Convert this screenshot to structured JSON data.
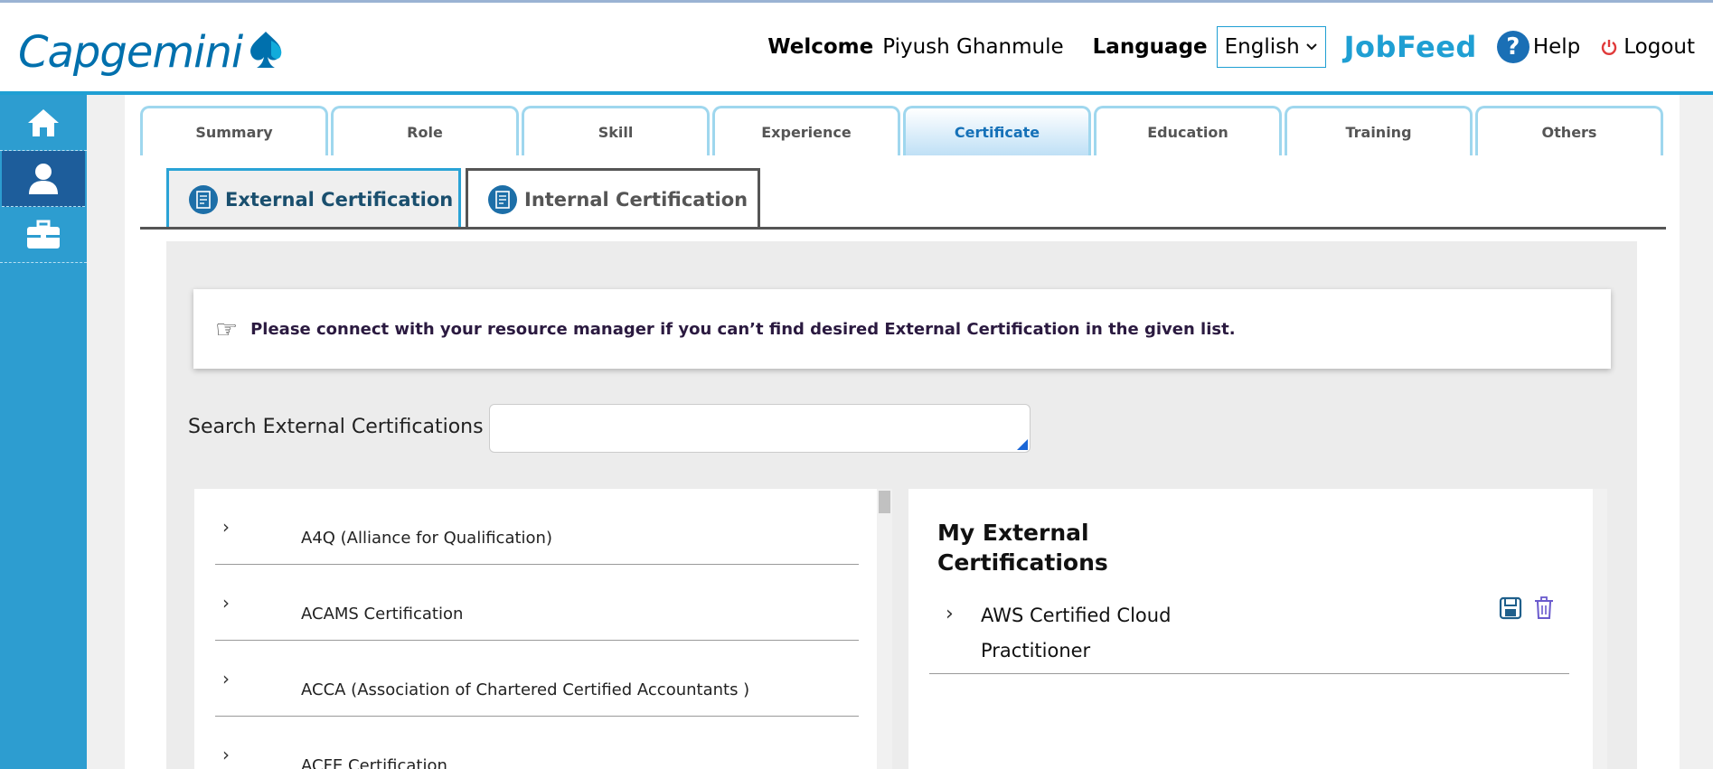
{
  "brand": {
    "logo_text": "Capgemini",
    "accent": "#1f9fd3",
    "logo_color": "#0070ad"
  },
  "header": {
    "welcome_label": "Welcome",
    "user_name": "Piyush Ghanmule",
    "language_label": "Language",
    "language_value": "English",
    "jobfeed": "JobFeed",
    "help": "Help",
    "logout": "Logout"
  },
  "sidebar": {
    "items": [
      {
        "icon": "home-icon"
      },
      {
        "icon": "user-icon",
        "active": true
      },
      {
        "icon": "briefcase-icon"
      }
    ]
  },
  "tabs": [
    {
      "label": "Summary"
    },
    {
      "label": "Role"
    },
    {
      "label": "Skill"
    },
    {
      "label": "Experience"
    },
    {
      "label": "Certificate",
      "active": true
    },
    {
      "label": "Education"
    },
    {
      "label": "Training"
    },
    {
      "label": "Others"
    }
  ],
  "subtabs": [
    {
      "label": "External Certification",
      "active": true
    },
    {
      "label": "Internal Certification"
    }
  ],
  "notice": {
    "text": "Please connect with your resource manager if you can’t find desired External Certification in the given list."
  },
  "search": {
    "label": "Search External Certifications",
    "value": "",
    "placeholder": ""
  },
  "cert_list": [
    {
      "name": "A4Q (Alliance for Qualification)"
    },
    {
      "name": "ACAMS Certification"
    },
    {
      "name": "ACCA (Association of Chartered Certified Accountants )"
    },
    {
      "name": "ACFE Certification"
    }
  ],
  "my_certs": {
    "title": "My External Certifications",
    "items": [
      {
        "name": "AWS Certified Cloud Practitioner"
      }
    ]
  }
}
